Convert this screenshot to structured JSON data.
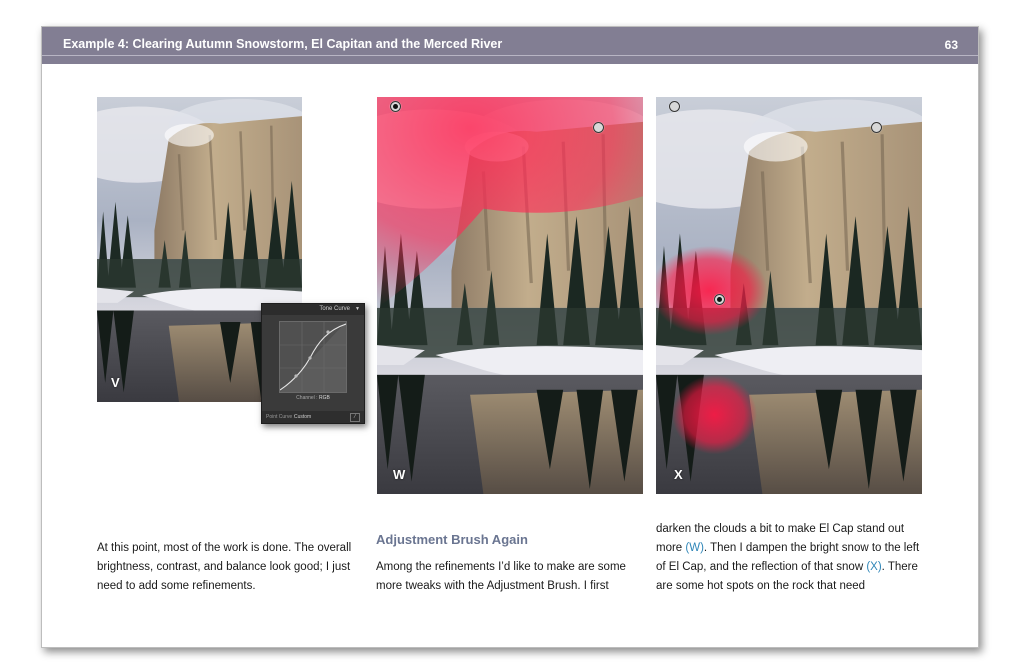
{
  "header": {
    "title": "Example 4: Clearing Autumn Snowstorm, El Capitan and the Merced River",
    "page_number": "63"
  },
  "figures": [
    {
      "label": "V"
    },
    {
      "label": "W"
    },
    {
      "label": "X"
    }
  ],
  "tone_curve": {
    "title": "Tone Curve",
    "channel_label": "Channel :",
    "channel_value": "RGB",
    "point_curve_label": "Point Curve :",
    "point_curve_value": "Custom"
  },
  "text": {
    "col1": "At this point, most of the work is done. The overall brightness, contrast, and balance look good; I just need to add some refinements.",
    "col2_heading": "Adjustment Brush Again",
    "col2": "Among the refinements I’d like to make are some more tweaks with the Adjustment Brush. I first",
    "col3_a": "darken the clouds a bit to make El Cap stand out more ",
    "col3_ref_w": "(W)",
    "col3_b": ". Then I dampen the bright snow to the left of El Cap, and the reflection of that snow ",
    "col3_ref_x": "(X)",
    "col3_c": ". There are some hot spots on the rock that need"
  },
  "colors": {
    "header_bar": "#827e93",
    "subhead": "#6a7591",
    "reference_link": "#2f86b8",
    "mask_overlay": "#ff2a55"
  }
}
